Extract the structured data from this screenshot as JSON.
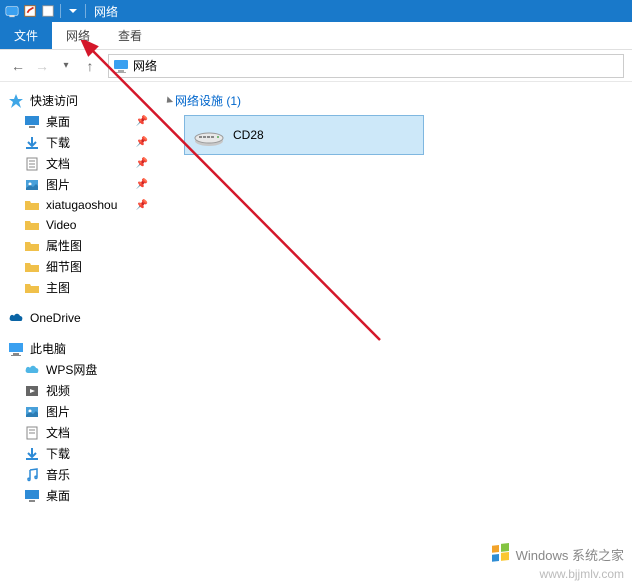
{
  "titlebar": {
    "title": "网络"
  },
  "ribbon": {
    "file": "文件",
    "network": "网络",
    "view": "查看"
  },
  "address": {
    "location": "网络"
  },
  "sidebar": {
    "quick_access": {
      "label": "快速访问",
      "items": [
        {
          "label": "桌面",
          "icon": "desktop",
          "pinned": true
        },
        {
          "label": "下载",
          "icon": "downloads",
          "pinned": true
        },
        {
          "label": "文档",
          "icon": "documents",
          "pinned": true
        },
        {
          "label": "图片",
          "icon": "pictures",
          "pinned": true
        },
        {
          "label": "xiatugaoshou",
          "icon": "folder",
          "pinned": true
        },
        {
          "label": "Video",
          "icon": "folder",
          "pinned": false
        },
        {
          "label": "属性图",
          "icon": "folder",
          "pinned": false
        },
        {
          "label": "细节图",
          "icon": "folder",
          "pinned": false
        },
        {
          "label": "主图",
          "icon": "folder",
          "pinned": false
        }
      ]
    },
    "onedrive": {
      "label": "OneDrive"
    },
    "this_pc": {
      "label": "此电脑",
      "items": [
        {
          "label": "WPS网盘",
          "icon": "wps"
        },
        {
          "label": "视频",
          "icon": "videos"
        },
        {
          "label": "图片",
          "icon": "pictures"
        },
        {
          "label": "文档",
          "icon": "documents"
        },
        {
          "label": "下载",
          "icon": "downloads"
        },
        {
          "label": "音乐",
          "icon": "music"
        },
        {
          "label": "桌面",
          "icon": "desktop"
        }
      ]
    }
  },
  "content": {
    "group_label": "网络设施 (1)",
    "device": {
      "name": "CD28"
    }
  },
  "watermark": {
    "brand": "Windows 系统之家",
    "url": "www.bjjmlv.com"
  }
}
